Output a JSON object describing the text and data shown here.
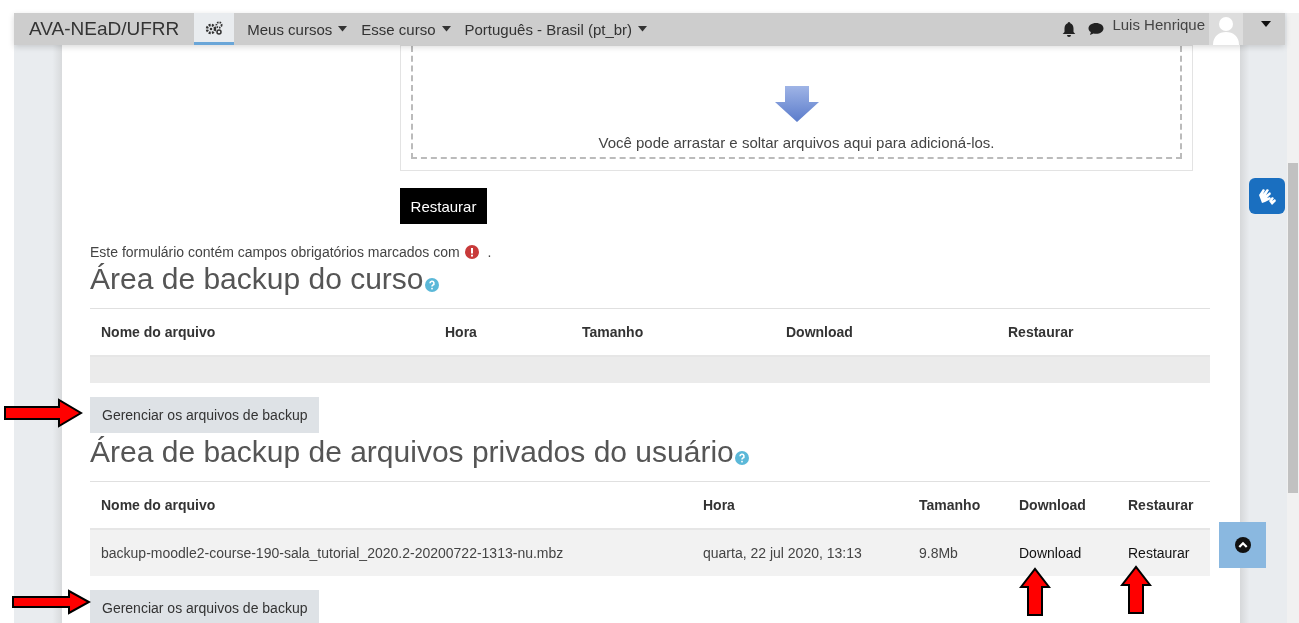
{
  "navbar": {
    "brand": "AVA-NEaD/UFRR",
    "menus": [
      {
        "label": "Meus cursos"
      },
      {
        "label": "Esse curso"
      },
      {
        "label": "Português - Brasil (pt_br)"
      }
    ],
    "user": "Luis Henrique"
  },
  "filepicker": {
    "hint": "Você pode arrastar e soltar arquivos aqui para adicioná-los."
  },
  "restore_button": "Restaurar",
  "required_note": {
    "text": "Este formulário contém campos obrigatórios marcados com",
    "end": "."
  },
  "sections": [
    {
      "title": "Área de backup do curso",
      "columns": [
        "Nome do arquivo",
        "Hora",
        "Tamanho",
        "Download",
        "Restaurar"
      ],
      "manage_button": "Gerenciar os arquivos de backup"
    },
    {
      "title": "Área de backup de arquivos privados do usuário",
      "columns": [
        "Nome do arquivo",
        "Hora",
        "Tamanho",
        "Download",
        "Restaurar"
      ],
      "rows": [
        {
          "name": "backup-moodle2-course-190-sala_tutorial_2020.2-20200722-1313-nu.mbz",
          "time": "quarta, 22 jul 2020, 13:13",
          "size": "9.8Mb",
          "download": "Download",
          "restore": "Restaurar"
        }
      ],
      "manage_button": "Gerenciar os arquivos de backup"
    }
  ]
}
